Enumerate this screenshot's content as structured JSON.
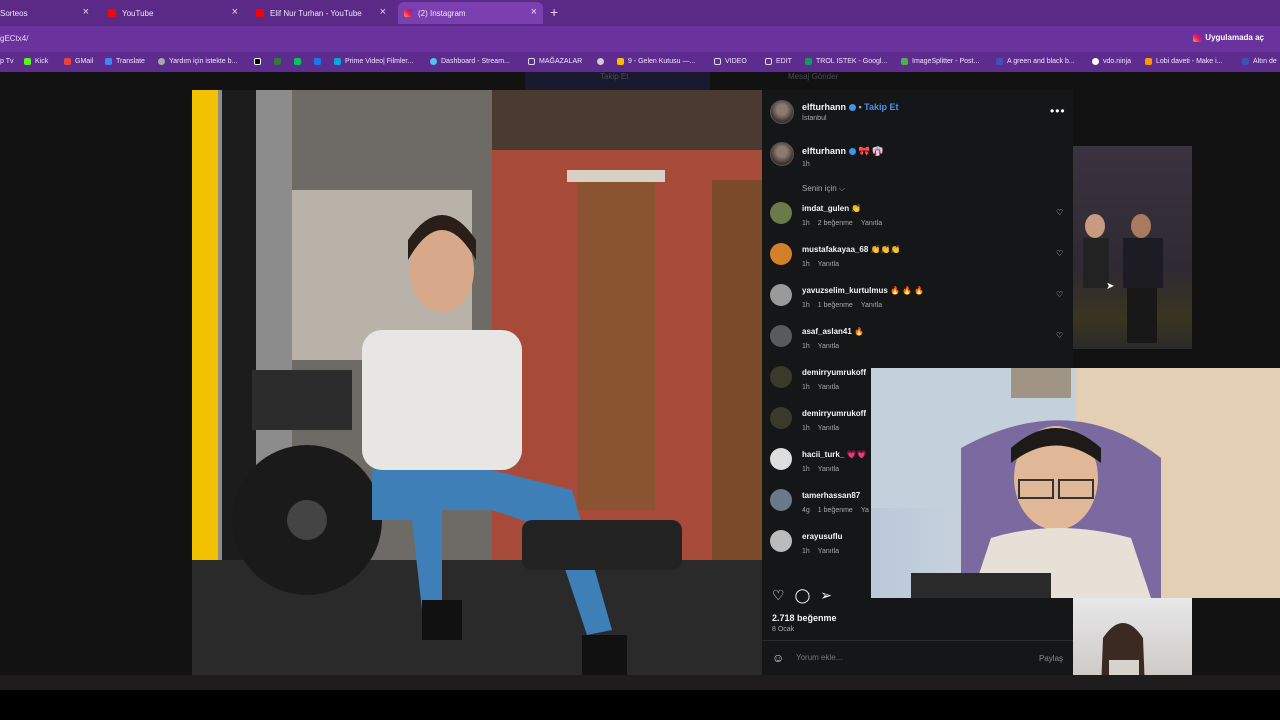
{
  "tabs": [
    {
      "title": "Sorteos",
      "color": "#6a329c"
    },
    {
      "title": "YouTube",
      "color": "#ff0000"
    },
    {
      "title": "Elif Nur Turhan - YouTube",
      "color": "#ff0000"
    },
    {
      "title": "(2) Instagram",
      "color": "#e1306c"
    }
  ],
  "url": "gECtx4/",
  "open_app_label": "Uygulamada aç",
  "bookmarks": [
    "p Tv",
    "Kick",
    "GMail",
    "Translate",
    "Yardım için istekte b...",
    "",
    "",
    "",
    "",
    "Prime Video| Filmler...",
    "Dashboard - Stream...",
    "MAĞAZALAR",
    "",
    "9 - Gelen Kutusu —...",
    "VIDEO",
    "EDIT",
    "TROL ISTEK - Googl...",
    "ImageSplitter - Post...",
    "A green and black b...",
    "vdo.ninja",
    "Lobi daveti - Make i...",
    "Altın de"
  ],
  "behind": {
    "follow": "Takip Et",
    "message": "Mesaj Gönder"
  },
  "post": {
    "username": "elfturhann",
    "follow_label": "Takip Et",
    "location": "İstanbul",
    "caption_user": "elfturhann",
    "caption_emoji": "🎀 👘",
    "caption_time": "1h",
    "for_you": "Senin için",
    "comments": [
      {
        "user": "imdat_gulen",
        "emoji": "👏 ",
        "time": "1h",
        "likes": "2 beğenme",
        "reply": "Yanıtla",
        "avatar": "#6b7a4a"
      },
      {
        "user": "mustafakayaa_68",
        "emoji": "👏👏👏",
        "time": "1h",
        "likes": "",
        "reply": "Yanıtla",
        "avatar": "#d4802a"
      },
      {
        "user": "yavuzselim_kurtulmus",
        "emoji": "🔥 🔥 🔥",
        "time": "1h",
        "likes": "1 beğenme",
        "reply": "Yanıtla",
        "avatar": "#9a9a9a"
      },
      {
        "user": "asaf_aslan41",
        "emoji": "🔥",
        "time": "1h",
        "likes": "",
        "reply": "Yanıtla",
        "avatar": "#5a5a5a"
      },
      {
        "user": "demirryumrukoff",
        "emoji": "",
        "time": "1h",
        "likes": "",
        "reply": "Yanıtla",
        "avatar": "#3a3a2a"
      },
      {
        "user": "demirryumrukoff",
        "emoji": "",
        "time": "1h",
        "likes": "",
        "reply": "Yanıtla",
        "avatar": "#3a3a2a"
      },
      {
        "user": "hacii_turk_",
        "emoji": "💗💗",
        "time": "1h",
        "likes": "",
        "reply": "Yanıtla",
        "avatar": "#ddd"
      },
      {
        "user": "tamerhassan87",
        "emoji": "",
        "time": "4g",
        "likes": "1 beğenme",
        "reply": "Ya",
        "avatar": "#6a7a8a"
      },
      {
        "user": "erayusuflu",
        "emoji": "",
        "time": "1h",
        "likes": "",
        "reply": "Yanıtla",
        "avatar": "#bbb"
      }
    ],
    "like_count": "2.718 beğenme",
    "post_date": "8 Ocak",
    "comment_placeholder": "Yorum ekle...",
    "post_button": "Paylaş"
  },
  "icons": {
    "heart": "heart-icon",
    "comment": "comment-icon",
    "share": "share-icon",
    "more": "more-icon",
    "emoji": "emoji-icon"
  }
}
